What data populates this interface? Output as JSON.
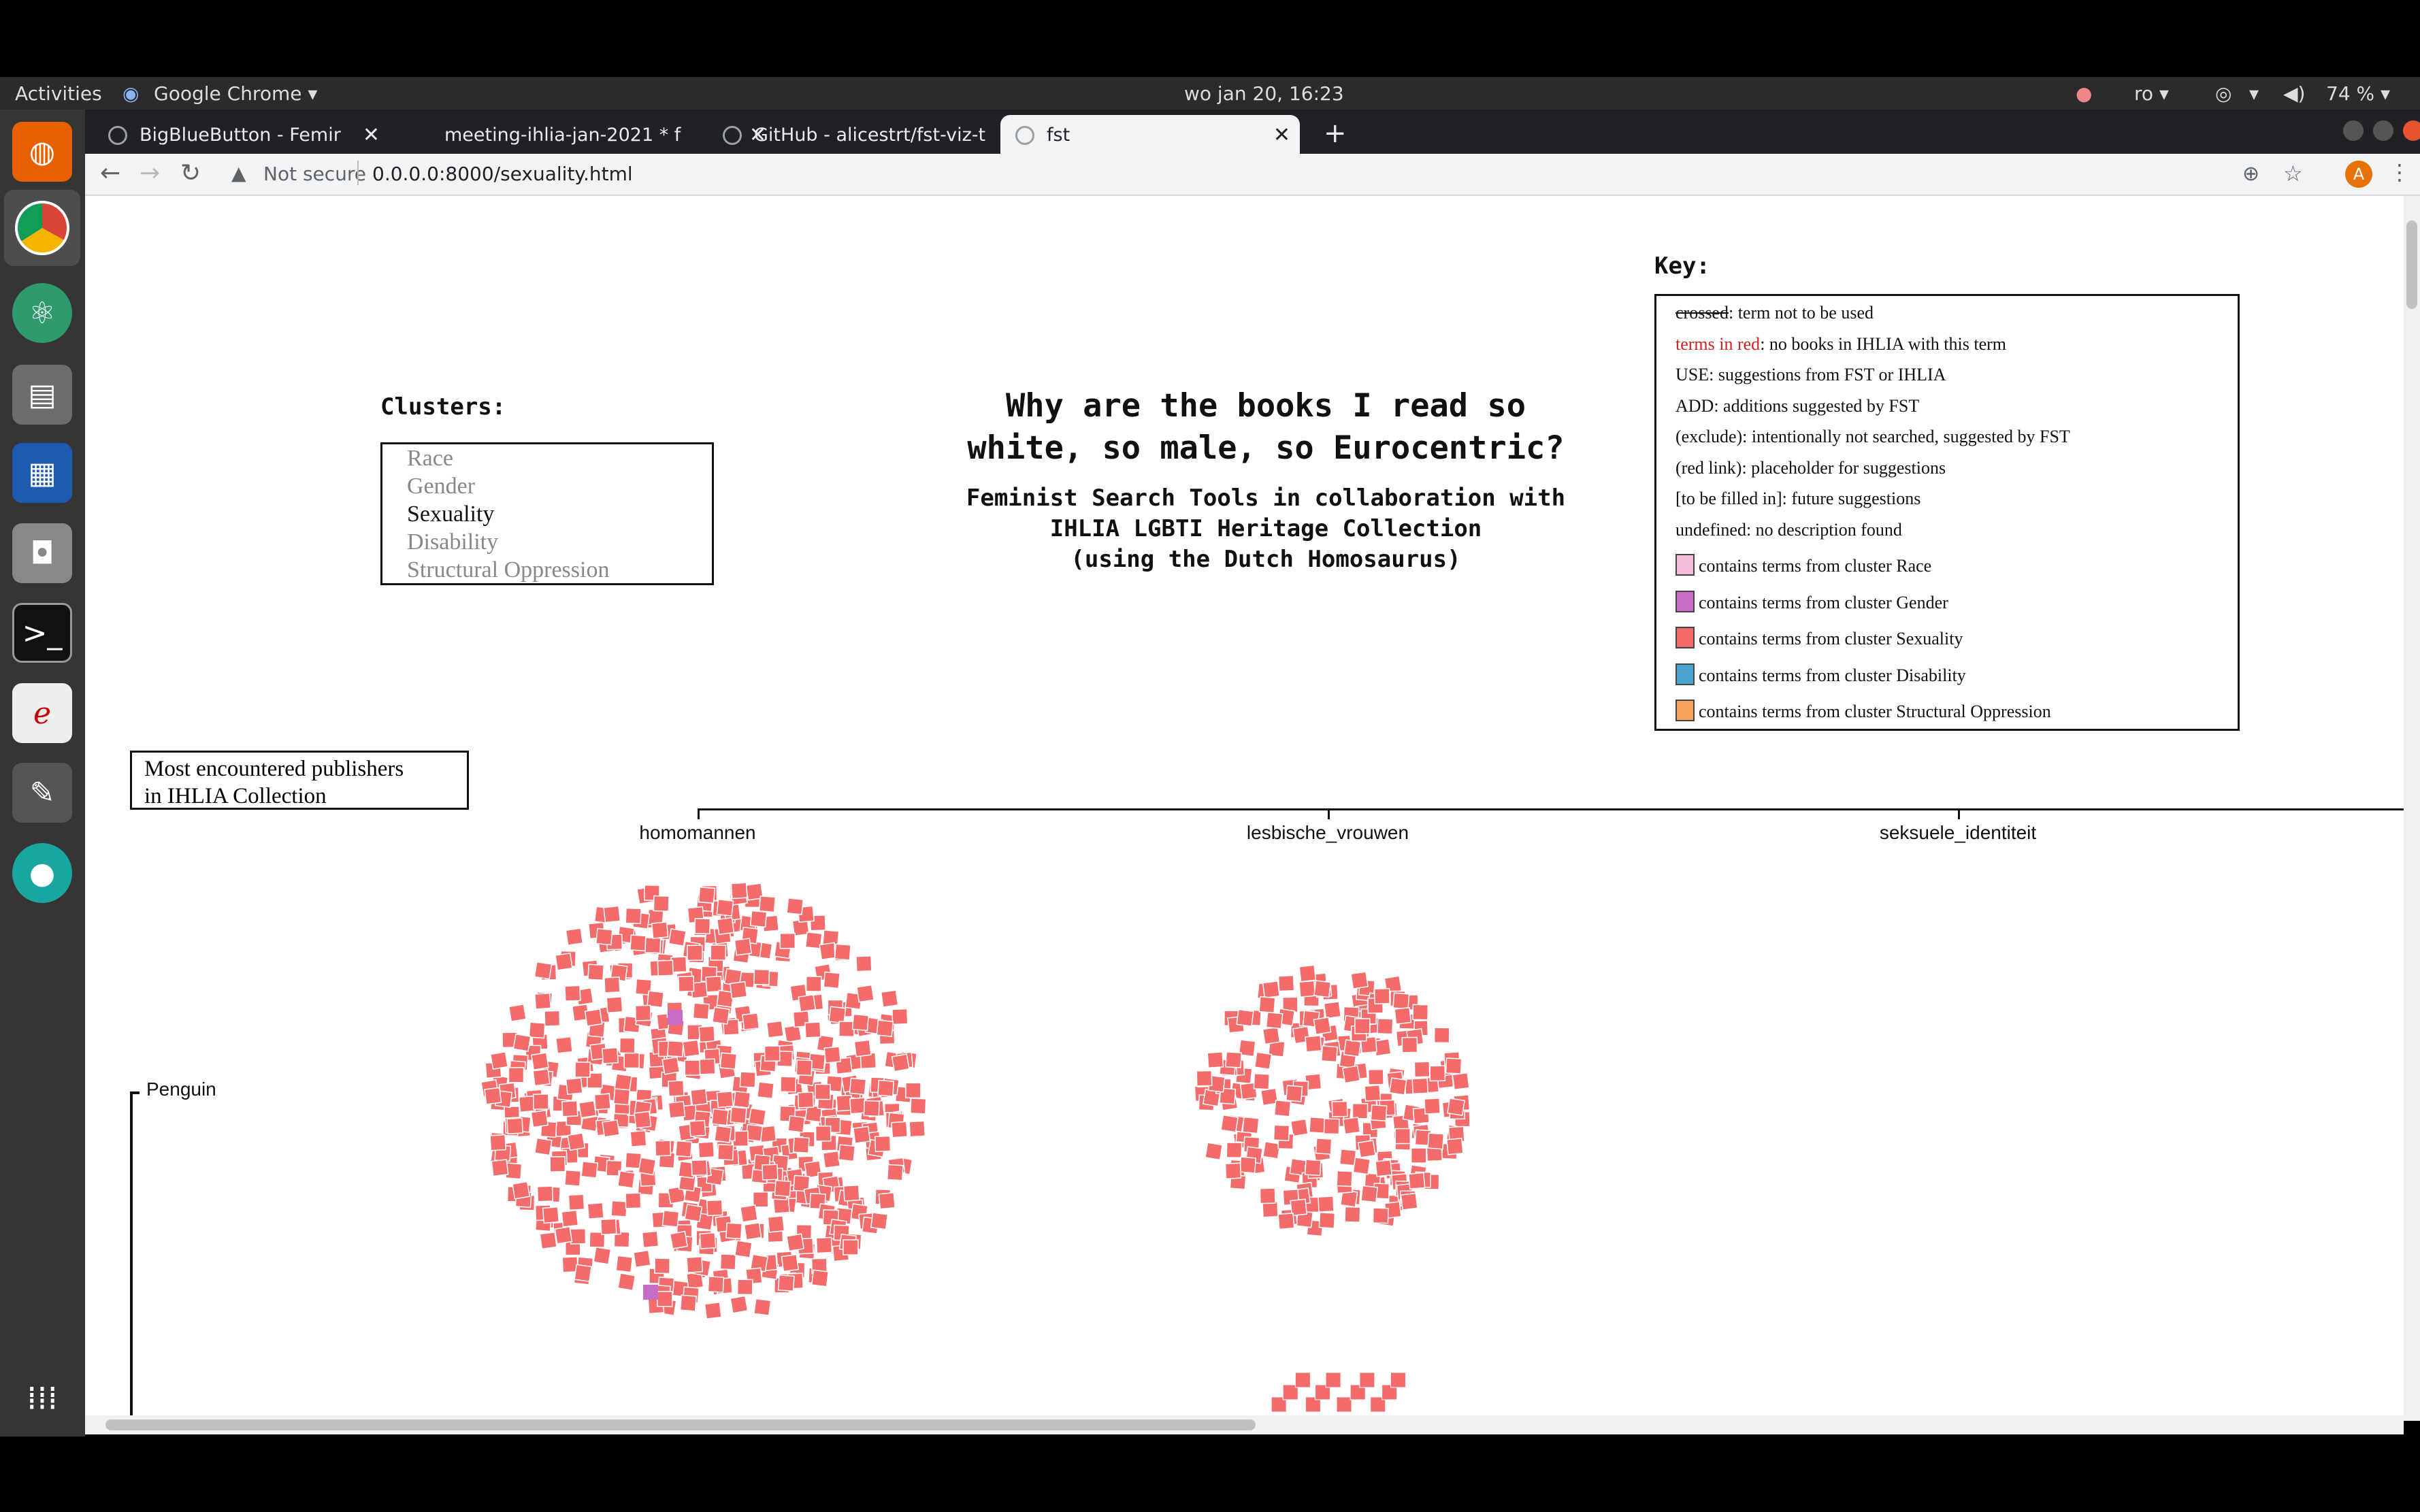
{
  "system": {
    "activities": "Activities",
    "app_menu": "Google Chrome ▾",
    "clock": "wo jan 20, 16:23",
    "lang": "ro ▾",
    "battery": "74 % ▾"
  },
  "tabs": [
    {
      "label": "BigBlueButton - Femir",
      "active": false
    },
    {
      "label": "meeting-ihlia-jan-2021 * f",
      "active": false
    },
    {
      "label": "GitHub - alicestrt/fst-viz-t",
      "active": false
    },
    {
      "label": "fst",
      "active": true
    }
  ],
  "omnibox": {
    "security": "Not secure",
    "url": "0.0.0.0:8000/sexuality.html"
  },
  "avatar_letter": "A",
  "clusters": {
    "title": "Clusters:",
    "items": [
      "Race",
      "Gender",
      "Sexuality",
      "Disability",
      "Structural Oppression"
    ],
    "selected": "Sexuality"
  },
  "title": {
    "line1": "Why are the books I read so",
    "line2": "white, so male, so Eurocentric?",
    "sub1": "Feminist Search Tools in collaboration with",
    "sub2": "IHLIA LGBTI Heritage Collection",
    "sub3": "(using the Dutch Homosaurus)"
  },
  "key": {
    "title": "Key:",
    "rows": [
      {
        "term": "crossed",
        "rest": ": term not to be used",
        "style": "strike"
      },
      {
        "term": "terms in red",
        "rest": ": no books in IHLIA with this term",
        "style": "red"
      },
      {
        "term": "",
        "rest": "USE: suggestions from FST or IHLIA",
        "style": ""
      },
      {
        "term": "",
        "rest": "ADD: additions suggested by FST",
        "style": ""
      },
      {
        "term": "",
        "rest": "(exclude): intentionally not searched, suggested by FST",
        "style": ""
      },
      {
        "term": "",
        "rest": "(red link): placeholder for suggestions",
        "style": ""
      },
      {
        "term": "",
        "rest": "[to be filled in]: future suggestions",
        "style": ""
      },
      {
        "term": "",
        "rest": "undefined: no description found",
        "style": ""
      }
    ],
    "swatches": [
      {
        "color": "#f7bcd9",
        "label": "contains terms from cluster Race"
      },
      {
        "color": "#c86dc3",
        "label": "contains terms from cluster Gender"
      },
      {
        "color": "#f36b6b",
        "label": "contains terms from cluster Sexuality"
      },
      {
        "color": "#4aa3d3",
        "label": "contains terms from cluster Disability"
      },
      {
        "color": "#f8a35c",
        "label": "contains terms from cluster Structural Oppression"
      }
    ]
  },
  "publishers_box": {
    "line1": "Most encountered publishers",
    "line2": "in IHLIA Collection"
  },
  "chart_data": {
    "type": "scatter",
    "columns": [
      "homomannen",
      "lesbische_vrouwen",
      "seksuele_identiteit"
    ],
    "rows": [
      "Penguin"
    ],
    "clusters": [
      {
        "column": "homomannen",
        "row": "Penguin",
        "count": 620
      },
      {
        "column": "lesbische_vrouwen",
        "row": "Penguin",
        "count": 230
      }
    ],
    "accent_colors": {
      "sexuality": "#f36b6b",
      "gender": "#c86dc3"
    }
  }
}
